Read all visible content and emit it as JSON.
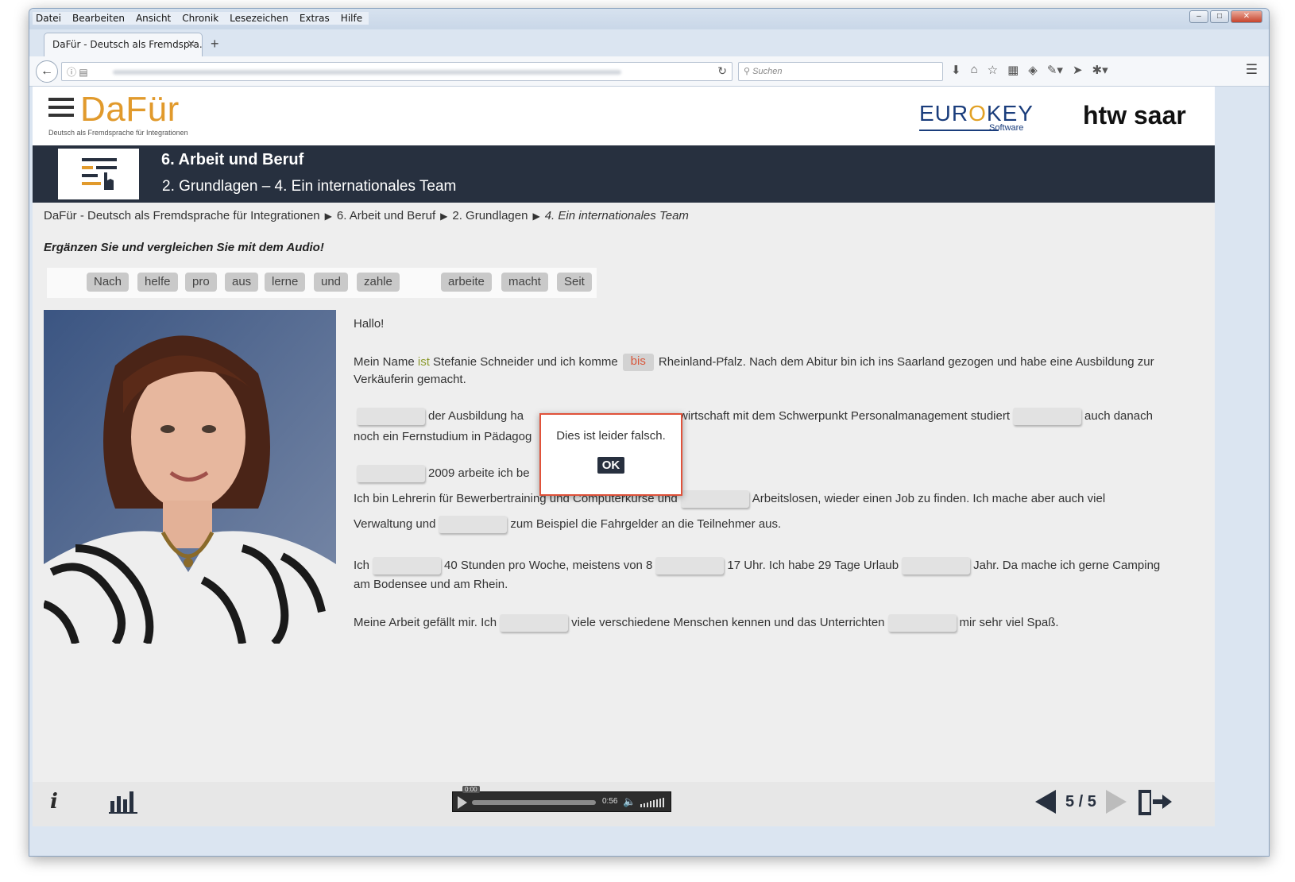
{
  "browser": {
    "menu": [
      "Datei",
      "Bearbeiten",
      "Ansicht",
      "Chronik",
      "Lesezeichen",
      "Extras",
      "Hilfe"
    ],
    "tab_title": "DaFür - Deutsch als Fremdspra...",
    "tab_close": "×",
    "new_tab": "+",
    "search_placeholder": "Suchen"
  },
  "header": {
    "logo": "DaFür",
    "logo_sub": "Deutsch als Fremdsprache für Integrationen",
    "eurokey": "EUR",
    "eurokey_o": "O",
    "eurokey_end": "KEY",
    "eurokey_sub": "Software",
    "htw": "htw saar"
  },
  "banner": {
    "title": "6. Arbeit und Beruf",
    "subtitle": "2. Grundlagen – 4. Ein internationales Team"
  },
  "breadcrumb": [
    "DaFür - Deutsch als Fremdsprache für Integrationen",
    "6. Arbeit und Beruf",
    "2. Grundlagen",
    "4. Ein internationales Team"
  ],
  "instruction": "Ergänzen Sie und vergleichen Sie mit dem Audio!",
  "word_bank": [
    "Nach",
    "helfe",
    "pro",
    "aus",
    "lerne",
    "und",
    "zahle",
    "arbeite",
    "macht",
    "Seit"
  ],
  "text": {
    "greeting": "Hallo!",
    "l1a": "Mein Name ",
    "l1_ist": "ist",
    "l1b": " Stefanie Schneider und ich komme",
    "l1_filled": "bis",
    "l1c": "Rheinland-Pfalz. Nach dem Abitur bin ich ins Saarland gezogen und habe eine Ausbildung zur",
    "l2": "Verkäuferin gemacht.",
    "l3a": "der Ausbildung ha",
    "l3b": "wirtschaft mit dem Schwerpunkt Personalmanagement studiert",
    "l3c": "auch danach",
    "l4": "noch ein Fernstudium in Pädagog",
    "l5": "2009 arbeite ich be",
    "l6a": "Ich bin Lehrerin für Bewerbertraining und Computerkurse und",
    "l6b": "Arbeitslosen, wieder einen Job zu finden. Ich mache aber auch viel",
    "l7a": "Verwaltung und",
    "l7b": "zum Beispiel die Fahrgelder an die Teilnehmer aus.",
    "l8a": "Ich",
    "l8b": "40 Stunden pro Woche, meistens von 8",
    "l8c": "17 Uhr. Ich habe 29 Tage Urlaub",
    "l8d": "Jahr. Da mache ich gerne Camping",
    "l9": "am Bodensee und am Rhein.",
    "l10a": "Meine Arbeit gefällt mir. Ich",
    "l10b": "viele verschiedene Menschen kennen und das Unterrichten",
    "l10c": "mir sehr viel Spaß."
  },
  "dialog": {
    "message": "Dies ist leider falsch.",
    "ok": "OK"
  },
  "footer": {
    "info": "i",
    "audio_bubble": "0:00",
    "audio_time": "0:56",
    "page": "5 / 5"
  },
  "colors": {
    "accent": "#e19a2c",
    "banner": "#27303f",
    "error": "#e0523a"
  }
}
